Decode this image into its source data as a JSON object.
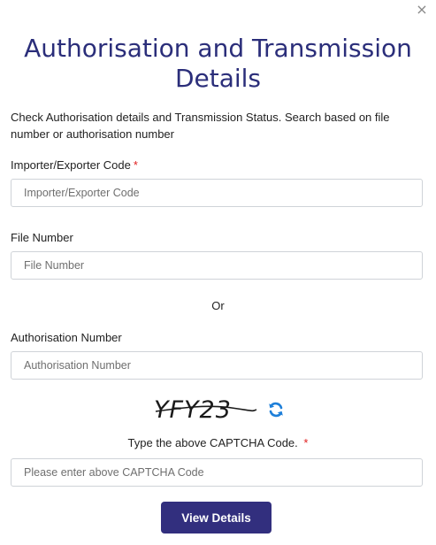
{
  "dialog": {
    "close_label": "×",
    "title": "Authorisation and Transmission Details",
    "description": "Check Authorisation details and Transmission Status. Search based on file number or authorisation number"
  },
  "form": {
    "iec": {
      "label": "Importer/Exporter Code",
      "required_mark": "*",
      "placeholder": "Importer/Exporter Code",
      "value": ""
    },
    "file_number": {
      "label": "File Number",
      "placeholder": "File Number",
      "value": ""
    },
    "or_text": "Or",
    "auth_number": {
      "label": "Authorisation Number",
      "placeholder": "Authorisation Number",
      "value": ""
    },
    "captcha": {
      "image_text": "YFY23",
      "label": "Type the above CAPTCHA Code.",
      "required_mark": "*",
      "placeholder": "Please enter above CAPTCHA Code",
      "value": "",
      "refresh_icon": "refresh-icon"
    },
    "submit_label": "View Details"
  },
  "colors": {
    "title": "#2b2e7a",
    "button": "#322f7e",
    "required": "#e02020",
    "refresh": "#1e7fd9"
  }
}
